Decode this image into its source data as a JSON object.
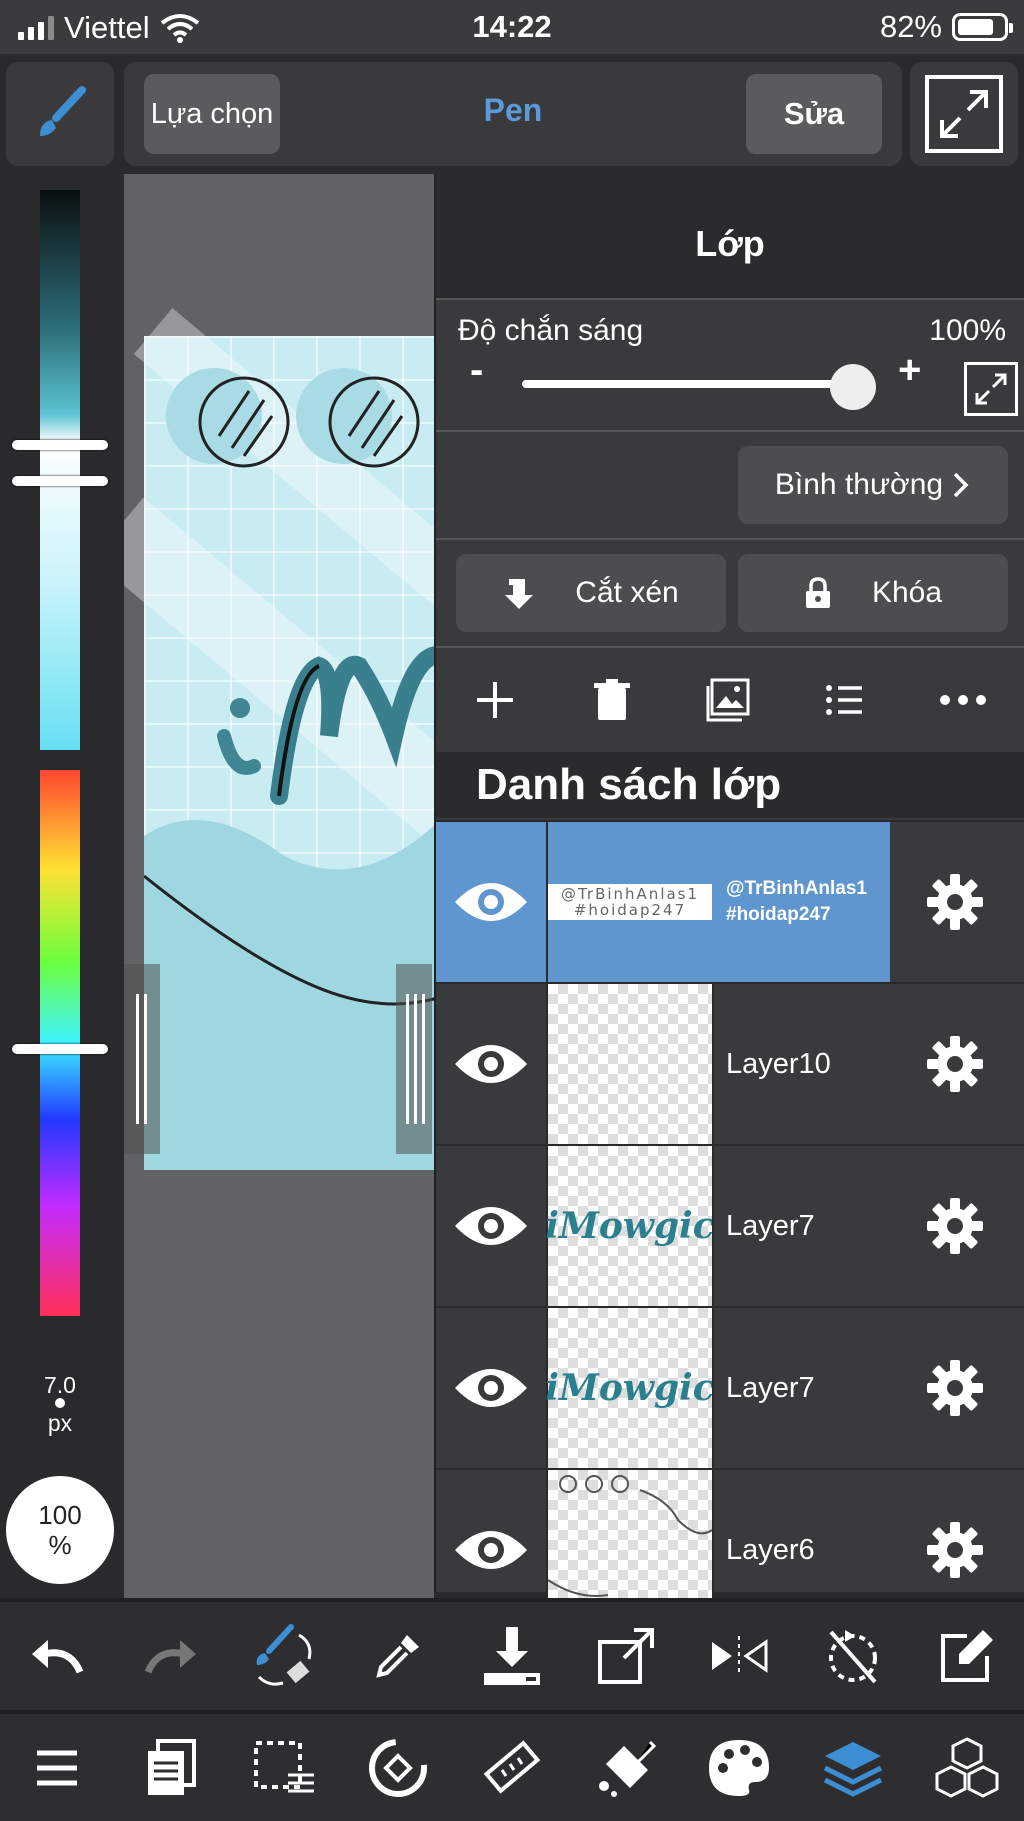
{
  "status_bar": {
    "carrier": "Viettel",
    "time": "14:22",
    "battery": "82%"
  },
  "toolbar": {
    "select_label": "Lựa chọn",
    "mode_label": "Pen",
    "edit_label": "Sửa"
  },
  "left_panel": {
    "brush_size_value": "7.0",
    "brush_size_unit": "px",
    "opacity_value": "100",
    "opacity_unit": "%"
  },
  "layer_panel": {
    "title": "Lớp",
    "opacity_label": "Độ chắn sáng",
    "opacity_value": "100%",
    "opacity_level": 1.0,
    "minus": "-",
    "plus": "+",
    "blend_mode": "Bình thường",
    "clip_label": "Cắt xén",
    "lock_label": "Khóa",
    "list_title": "Danh sách lớp",
    "layers": [
      {
        "name_line1": "@TrBinhAnlas1",
        "name_line2": "#hoidap247",
        "thumb_line1": "@TrBinhAnlas1",
        "thumb_line2": "#hoidap247",
        "active": true
      },
      {
        "name": "Layer10"
      },
      {
        "name": "Layer7",
        "thumb_text": "iMowgic"
      },
      {
        "name": "Layer7",
        "thumb_text": "iMowgic"
      },
      {
        "name": "Layer6"
      }
    ]
  },
  "colors": {
    "accent": "#5c9ad8",
    "active_layer": "#5f96cf",
    "panel": "#3a3a3c"
  }
}
